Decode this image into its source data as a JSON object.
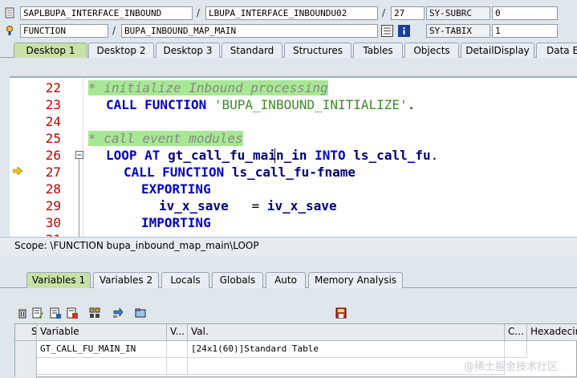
{
  "header": {
    "program": "SAPLBUPA_INTERFACE_INBOUND",
    "include": "LBUPA_INTERFACE_INBOUNDU02",
    "line": "27",
    "sy_subrc_label": "SY-SUBRC",
    "sy_subrc_value": "0",
    "event_type": "FUNCTION",
    "event": "BUPA_INBOUND_MAP_MAIN",
    "sy_tabix_label": "SY-TABIX",
    "sy_tabix_value": "1"
  },
  "top_tabs": [
    "Desktop 1",
    "Desktop 2",
    "Desktop 3",
    "Standard",
    "Structures",
    "Tables",
    "Objects",
    "DetailDisplay",
    "Data E"
  ],
  "code": {
    "lines": [
      "22",
      "23",
      "24",
      "25",
      "26",
      "27",
      "28",
      "29",
      "30"
    ],
    "c1": "* initialize Inbound processing",
    "l23_kw": "CALL FUNCTION",
    "l23_str": "'BUPA_INBOUND_INITIALIZE'",
    "l23_end": ".",
    "c2": "* call event modules",
    "l26_kw1": "LOOP AT",
    "l26_id1": "gt_call_fu_main_in",
    "l26_kw2": "INTO",
    "l26_id2": "ls_call_fu",
    "l26_end": ".",
    "l27_kw": "CALL FUNCTION",
    "l27_id": "ls_call_fu-fname",
    "l28_kw": "EXPORTING",
    "l29_id1": "iv_x_save",
    "l29_op": "=",
    "l29_id2": "iv_x_save",
    "l30_kw": "IMPORTING"
  },
  "scope": "Scope: \\FUNCTION bupa_inbound_map_main\\LOOP",
  "bottom_tabs": [
    "Variables 1",
    "Variables 2",
    "Locals",
    "Globals",
    "Auto",
    "Memory Analysis"
  ],
  "table": {
    "headers": [
      "S...",
      "Variable",
      "V...",
      "Val.",
      "C...",
      "Hexadecim"
    ],
    "rows": [
      {
        "variable": "GT_CALL_FU_MAIN_IN",
        "value": "[24x1(60)]Standard Table"
      }
    ]
  },
  "watermark": "@稀土掘金技术社区"
}
